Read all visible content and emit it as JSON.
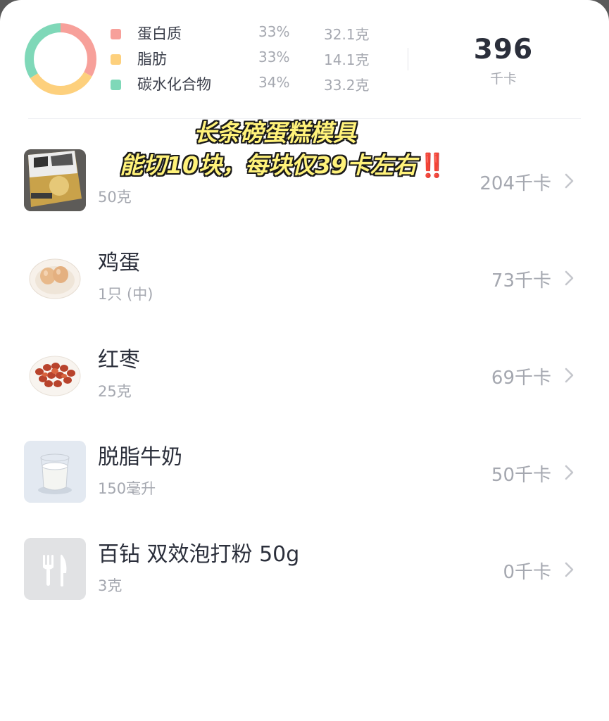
{
  "summary": {
    "colors": {
      "protein": "#f7a09a",
      "fat": "#fdd07d",
      "carb": "#7fd8b8"
    },
    "macros": [
      {
        "name": "蛋白质",
        "percent": "33%",
        "amount": "32.1克",
        "color": "#f7a09a",
        "share": 0.33
      },
      {
        "name": "脂肪",
        "percent": "33%",
        "amount": "14.1克",
        "color": "#fdd07d",
        "share": 0.33
      },
      {
        "name": "碳水化合物",
        "percent": "34%",
        "amount": "33.2克",
        "color": "#7fd8b8",
        "share": 0.34
      }
    ],
    "total_value": "396",
    "total_unit": "千卡"
  },
  "overlay": {
    "line1": "长条磅蛋糕模具",
    "line2": "能切10块，每块仅39卡左右",
    "emphasis": "‼️"
  },
  "foods": [
    {
      "name": "",
      "quantity": "50克",
      "calories": "204千卡",
      "icon": "flour-package-icon"
    },
    {
      "name": "鸡蛋",
      "quantity": "1只 (中)",
      "calories": "73千卡",
      "icon": "eggs-icon"
    },
    {
      "name": "红枣",
      "quantity": "25克",
      "calories": "69千卡",
      "icon": "red-dates-icon"
    },
    {
      "name": "脱脂牛奶",
      "quantity": "150毫升",
      "calories": "50千卡",
      "icon": "milk-glass-icon"
    },
    {
      "name": "百钻 双效泡打粉 50g",
      "quantity": "3克",
      "calories": "0千卡",
      "icon": "fork-knife-icon"
    }
  ]
}
